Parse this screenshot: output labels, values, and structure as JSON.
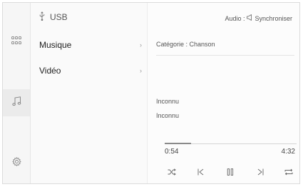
{
  "source": {
    "label": "USB",
    "icon": "usb-icon"
  },
  "rail": [
    {
      "icon": "apps-grid-icon",
      "active": false
    },
    {
      "icon": "music-note-icon",
      "active": true
    },
    {
      "icon": "settings-gear-icon",
      "active": false
    }
  ],
  "list": {
    "items": [
      {
        "label": "Musique",
        "chevron": "›"
      },
      {
        "label": "Vidéo",
        "chevron": "›"
      }
    ]
  },
  "main": {
    "audio_prefix": "Audio :",
    "audio_mode": "Synchroniser",
    "category": "Catégorie : Chanson",
    "title": "Inconnu",
    "artist": "Inconnu",
    "elapsed": "0:54",
    "duration": "4:32",
    "progress": 0.2
  },
  "controls": [
    "shuffle-icon",
    "previous-track-icon",
    "pause-icon",
    "next-track-icon",
    "repeat-icon"
  ],
  "colors": {
    "accent": "#8a8a8a",
    "background": "#fcfcfc",
    "divider": "#e4e4e4"
  }
}
